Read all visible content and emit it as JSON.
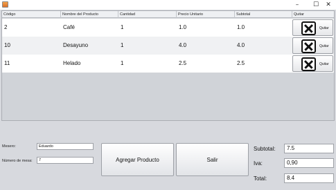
{
  "window": {
    "title": "",
    "minimize_glyph": "–",
    "maximize_glyph": "☐",
    "close_glyph": "✕"
  },
  "table": {
    "headers": [
      "Código",
      "Nombre del Producto",
      "Cantidad",
      "Precio Unitario",
      "Subtotal",
      "Quitar"
    ],
    "rows": [
      {
        "codigo": "2",
        "nombre": "Café",
        "cantidad": "1",
        "precio": "1.0",
        "subtotal": "1.0",
        "quitar": "Quitar"
      },
      {
        "codigo": "10",
        "nombre": "Desayuno",
        "cantidad": "1",
        "precio": "4.0",
        "subtotal": "4.0",
        "quitar": "Quitar"
      },
      {
        "codigo": "11",
        "nombre": "Helado",
        "cantidad": "1",
        "precio": "2.5",
        "subtotal": "2.5",
        "quitar": "Quitar"
      }
    ]
  },
  "form": {
    "mesero_label": "Mesero:",
    "mesero_value": "Eduardo",
    "mesa_label": "Número de mesa:",
    "mesa_value": "7"
  },
  "buttons": {
    "agregar": "Agregar Producto",
    "salir": "Salir"
  },
  "totals": {
    "subtotal_label": "Subtotal:",
    "subtotal_value": "7.5",
    "iva_label": "Iva:",
    "iva_value": "0,90",
    "total_label": "Total:",
    "total_value": "8.4"
  }
}
